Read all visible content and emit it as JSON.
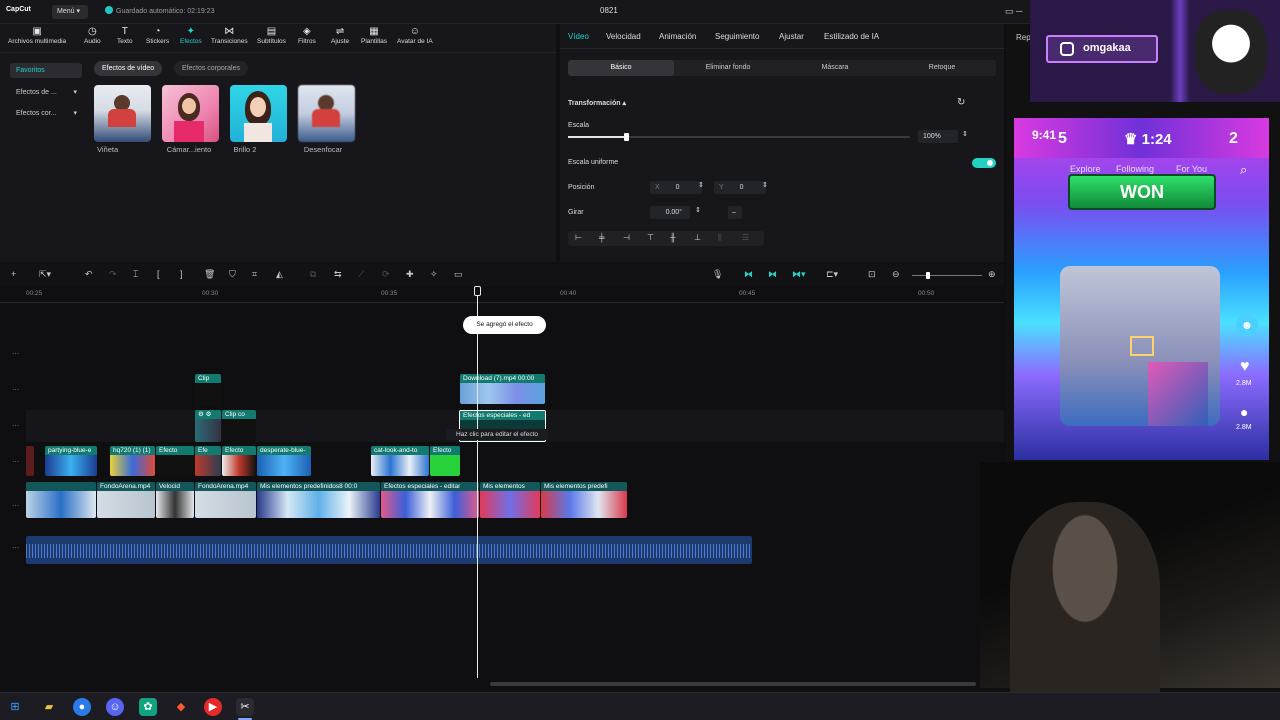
{
  "app": {
    "logo": "CapCut",
    "menu_label": "Menú",
    "autosave": "Guardado automático: 02:19:23",
    "project_title": "0821"
  },
  "toolbar": {
    "items": [
      {
        "label": "Archivos multimedia",
        "icon": "media-icon"
      },
      {
        "label": "Audio",
        "icon": "audio-icon"
      },
      {
        "label": "Texto",
        "icon": "text-icon"
      },
      {
        "label": "Stickers",
        "icon": "sticker-icon"
      },
      {
        "label": "Efectos",
        "icon": "effects-icon",
        "active": true
      },
      {
        "label": "Transiciones",
        "icon": "transition-icon"
      },
      {
        "label": "Subtítulos",
        "icon": "subtitle-icon"
      },
      {
        "label": "Filtros",
        "icon": "filter-icon"
      },
      {
        "label": "Ajuste",
        "icon": "adjust-icon"
      },
      {
        "label": "Plantillas",
        "icon": "template-icon"
      },
      {
        "label": "Avatar de IA",
        "icon": "ai-avatar-icon"
      }
    ]
  },
  "effects_panel": {
    "sidebar": [
      "Favoritos",
      "Efectos de ...",
      "Efectos cor..."
    ],
    "subtabs": [
      "Efectos de vídeo",
      "Efectos corporales"
    ],
    "items": [
      "Viñeta",
      "Cámar...iento",
      "Brillo 2",
      "Desenfocar"
    ]
  },
  "inspector": {
    "tabs": [
      "Vídeo",
      "Velocidad",
      "Animación",
      "Seguimiento",
      "Ajustar",
      "Estilizado de IA"
    ],
    "subtabs": [
      "Básico",
      "Eliminar fondo",
      "Máscara",
      "Retoque"
    ],
    "section_title": "Transformación",
    "scale_label": "Escala",
    "scale_value": "100%",
    "scale_fraction": 0.17,
    "uniform_label": "Escala uniforme",
    "position_label": "Posición",
    "pos_x_label": "X",
    "pos_x": "0",
    "pos_y_label": "Y",
    "pos_y": "0",
    "rotate_label": "Girar",
    "rotate_value": "0.00°",
    "rotate_dash": "–"
  },
  "timeline": {
    "ticks": [
      "00:25",
      "00:30",
      "00:35",
      "00:40",
      "00:45",
      "00:50"
    ],
    "toast": "Se agregó el efecto",
    "tooltip": "Haz clic para editar el efecto",
    "clips": {
      "c1": "Clip",
      "c2": "Download (7).mp4   00:00",
      "c3": "Clip co",
      "c4": "Efectos especiales - ed",
      "c5": "partying-blue-e",
      "c6": "hq720 (1) (1)",
      "c7": "Efecto",
      "c8": "Efe",
      "c9": "Efecto",
      "c10": "desperate-blue-",
      "c11": "cat-look-and-to",
      "c12": "Efecto",
      "c13": "FondoArena.mp4",
      "c14": "Velocid",
      "c15": "FondoArena.mp4",
      "c16": "Mis elementos predefinidos8   00:0",
      "c17": "Efectos especiales - editar",
      "c18": "Mis elementos",
      "c19": "Mis elementos predefi"
    }
  },
  "stream": {
    "instagram": "omgakaa",
    "side_label": "Rep",
    "phone": {
      "time": "9:41",
      "score_left": "5",
      "timer": "1:24",
      "score_right": "2",
      "nav": [
        "Explore",
        "Following",
        "For You"
      ],
      "banner": "WON",
      "likes": "2.8M",
      "comments": "2.8M"
    }
  }
}
